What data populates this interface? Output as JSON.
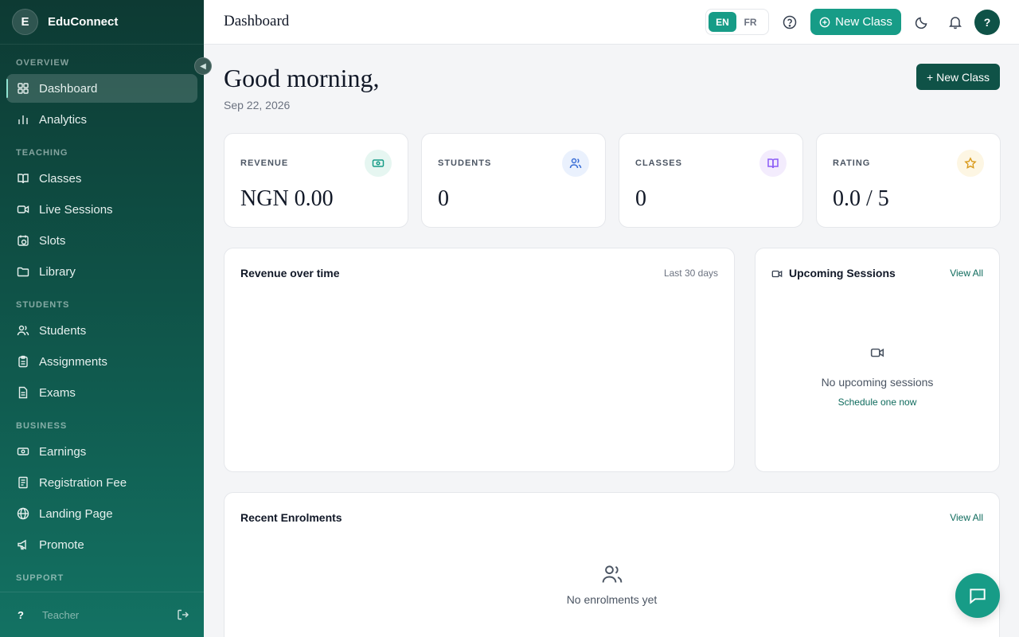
{
  "sidebar": {
    "brand_initial": "E",
    "brand_name": "EduConnect",
    "sections": {
      "overview": "OVERVIEW",
      "teaching": "TEACHING",
      "students": "STUDENTS",
      "business": "BUSINESS",
      "support": "SUPPORT"
    },
    "items": {
      "dashboard": "Dashboard",
      "analytics": "Analytics",
      "classes": "Classes",
      "live_sessions": "Live Sessions",
      "slots": "Slots",
      "library": "Library",
      "students": "Students",
      "assignments": "Assignments",
      "exams": "Exams",
      "earnings": "Earnings",
      "registration_fee": "Registration Fee",
      "landing_page": "Landing Page",
      "promote": "Promote"
    },
    "footer": {
      "help_glyph": "?",
      "role": "Teacher"
    }
  },
  "header": {
    "title": "Dashboard",
    "lang_en": "EN",
    "lang_fr": "FR",
    "new_class": "New Class",
    "avatar": "?"
  },
  "main": {
    "greeting": "Good morning,",
    "date": "Sep 22, 2026",
    "new_class": "+ New Class",
    "stats": {
      "revenue": {
        "label": "REVENUE",
        "value": "NGN 0.00"
      },
      "students": {
        "label": "STUDENTS",
        "value": "0"
      },
      "classes": {
        "label": "CLASSES",
        "value": "0"
      },
      "rating": {
        "label": "RATING",
        "value": "0.0 / 5"
      }
    },
    "revenue_panel": {
      "title": "Revenue over time",
      "range": "Last 30 days"
    },
    "sessions_panel": {
      "title": "Upcoming Sessions",
      "view_all": "View All",
      "empty": "No upcoming sessions",
      "cta": "Schedule one now"
    },
    "enrolments_panel": {
      "title": "Recent Enrolments",
      "view_all": "View All",
      "empty": "No enrolments yet"
    }
  },
  "colors": {
    "brand": "#179c87",
    "sidebar_dark": "#0d3a33",
    "accent_dark": "#0f5247"
  }
}
